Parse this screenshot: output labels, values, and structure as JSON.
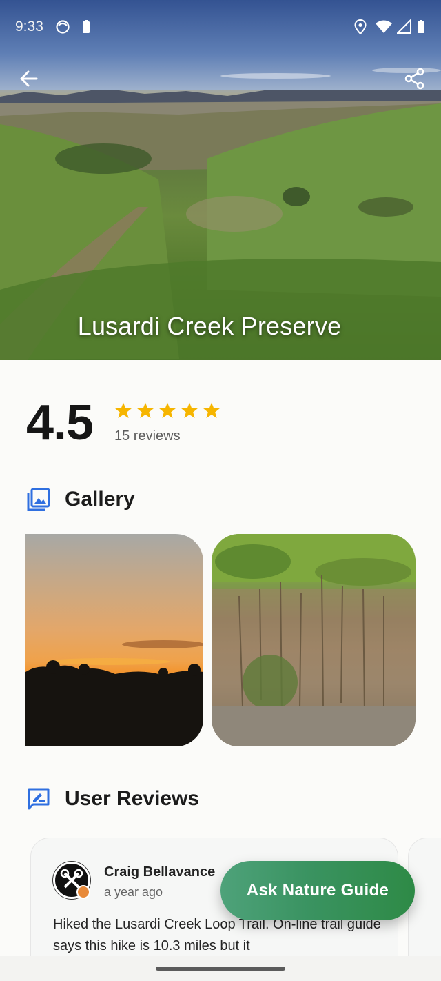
{
  "status_bar": {
    "time": "9:33"
  },
  "hero": {
    "title": "Lusardi Creek Preserve"
  },
  "rating": {
    "value": "4.5",
    "stars": 5,
    "reviews_label": "15 reviews",
    "star_color": "#f6b500"
  },
  "gallery": {
    "title": "Gallery",
    "icon": "gallery-icon",
    "accent": "#2f6fe0"
  },
  "reviews": {
    "title": "User Reviews",
    "icon": "rate-review-icon",
    "items": [
      {
        "name": "Craig Bellavance",
        "time": "a year ago",
        "text": "Hiked the Lusardi Creek Loop Trail.  On-line trail guide says this hike is 10.3 miles but it"
      }
    ]
  },
  "fab": {
    "label": "Ask Nature Guide",
    "color": "#2e8a46"
  }
}
